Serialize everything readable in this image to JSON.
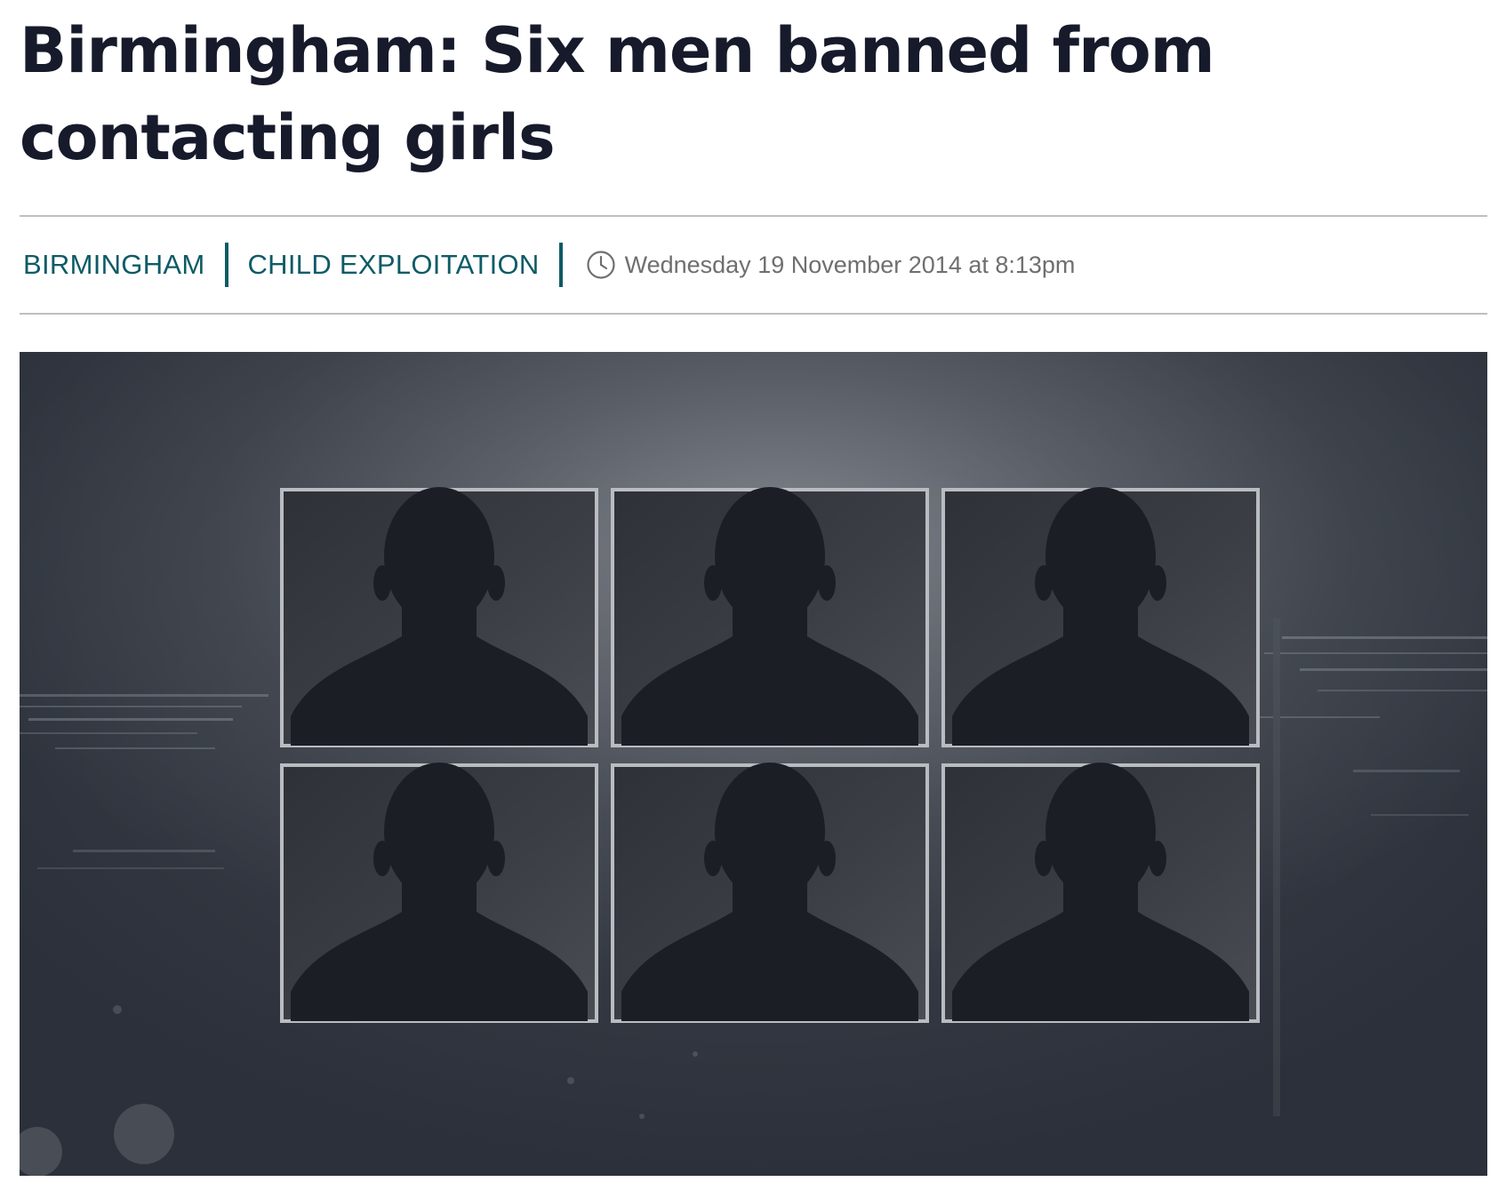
{
  "article": {
    "headline": "Birmingham: Six men banned from contacting girls"
  },
  "meta": {
    "tags": [
      "BIRMINGHAM",
      "CHILD EXPLOITATION"
    ],
    "published": "Wednesday 19 November 2014 at 8:13pm",
    "clock_icon": "clock-icon",
    "tag_color": "#0e5b66"
  },
  "hero_image": {
    "silhouette_count": 6,
    "grid_rows": 2,
    "grid_cols": 3
  }
}
